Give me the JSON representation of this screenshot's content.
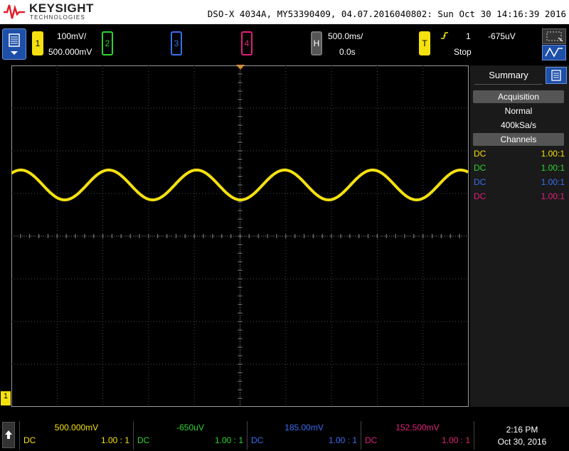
{
  "title_bar": {
    "brand": "KEYSIGHT",
    "brand_sub": "TECHNOLOGIES",
    "instrument_info": "DSO-X 4034A, MY53390409, 04.07.2016040802: Sun Oct 30 14:16:39 2016"
  },
  "channels": [
    {
      "label": "1",
      "scale": "100mV/",
      "offset": "500.000mV",
      "color": "#f4e10f"
    },
    {
      "label": "2",
      "color": "#2fd42f"
    },
    {
      "label": "3",
      "color": "#3a6ef0"
    },
    {
      "label": "4",
      "color": "#e0207a"
    }
  ],
  "horizontal": {
    "label": "H",
    "timebase": "500.0ms/",
    "delay": "0.0s"
  },
  "trigger": {
    "label": "T",
    "source": "1",
    "level": "-675uV",
    "status": "Stop"
  },
  "side_panel": {
    "tab": "Summary",
    "acquisition_title": "Acquisition",
    "acq_mode": "Normal",
    "sample_rate": "400kSa/s",
    "channels_title": "Channels",
    "rows": [
      {
        "coupling": "DC",
        "probe": "1.00:1",
        "color": "#f4e10f"
      },
      {
        "coupling": "DC",
        "probe": "1.00:1",
        "color": "#2fd42f"
      },
      {
        "coupling": "DC",
        "probe": "1.00:1",
        "color": "#3a6ef0"
      },
      {
        "coupling": "DC",
        "probe": "1.00:1",
        "color": "#e0207a"
      }
    ]
  },
  "ground_marker": "1",
  "bottom_bar": {
    "cells": [
      {
        "offset": "500.000mV",
        "coupling": "DC",
        "probe": "1.00 : 1",
        "color": "#f4e10f"
      },
      {
        "offset": "-650uV",
        "coupling": "DC",
        "probe": "1.00 : 1",
        "color": "#2fd42f"
      },
      {
        "offset": "185.00mV",
        "coupling": "DC",
        "probe": "1.00 : 1",
        "color": "#3a6ef0"
      },
      {
        "offset": "152.500mV",
        "coupling": "DC",
        "probe": "1.00 : 1",
        "color": "#e0207a"
      }
    ],
    "time": "2:16 PM",
    "date": "Oct 30, 2016"
  },
  "waveform": {
    "color": "#f4e10f",
    "cycles": 5.2,
    "center_div": 2.8,
    "amplitude_div": 0.35
  }
}
